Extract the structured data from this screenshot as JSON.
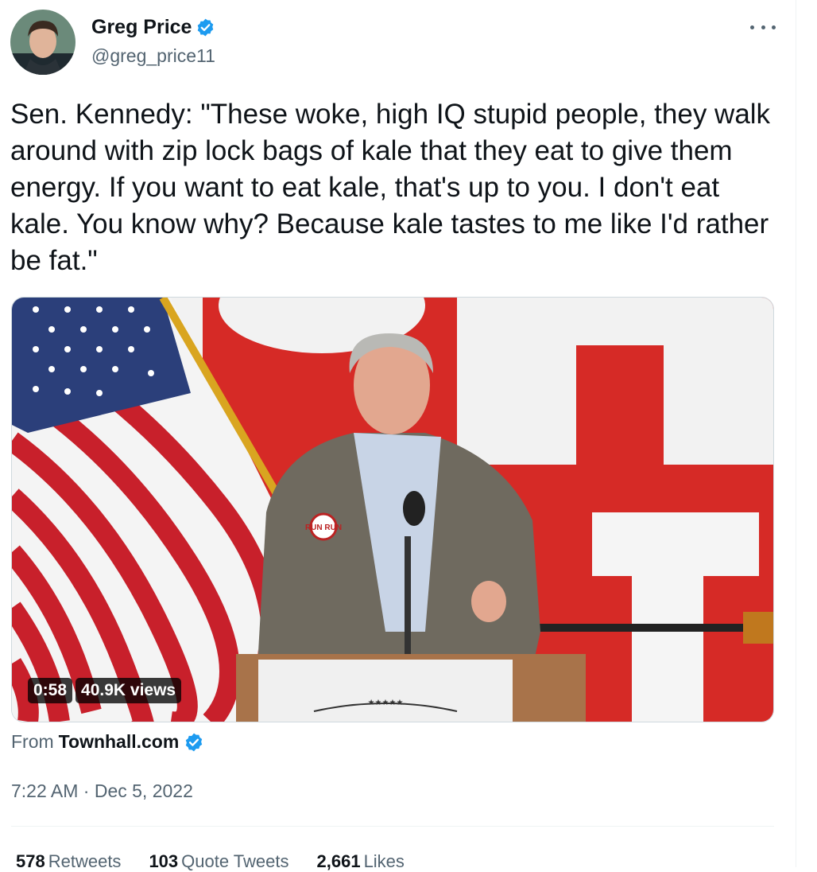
{
  "author": {
    "name": "Greg Price",
    "handle": "@greg_price11",
    "verified": true
  },
  "tweet": {
    "text": "Sen. Kennedy: \"These woke, high IQ stupid people, they walk around with zip lock bags of kale that they eat to give them energy. If you want to eat kale, that's up to you. I don't eat kale. You know why? Because kale tastes to me like I'd rather be fat.\""
  },
  "media": {
    "duration": "0:58",
    "views": "40.9K views",
    "button_text": "RUN RUN"
  },
  "source": {
    "prefix": "From",
    "name": "Townhall.com",
    "verified": true
  },
  "meta": {
    "time": "7:22 AM",
    "separator": "·",
    "date": "Dec 5, 2022"
  },
  "stats": [
    {
      "count": "578",
      "label": "Retweets"
    },
    {
      "count": "103",
      "label": "Quote Tweets"
    },
    {
      "count": "2,661",
      "label": "Likes"
    }
  ],
  "colors": {
    "verified_blue": "#1d9bf0",
    "text_primary": "#0f1419",
    "text_secondary": "#536471",
    "banner_red": "#d62a26"
  },
  "icons": {
    "verified": "verified-badge-icon",
    "more": "more-options-icon"
  }
}
